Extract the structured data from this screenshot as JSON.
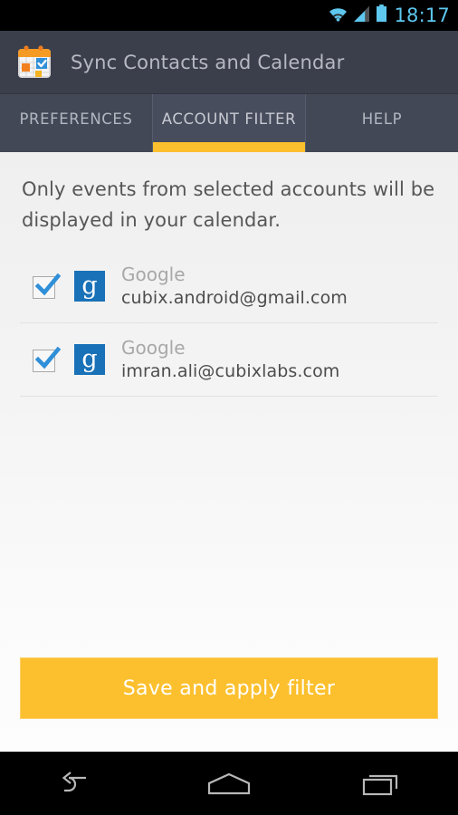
{
  "status_bar": {
    "time": "18:17",
    "icons": [
      "wifi-icon",
      "cellular-signal-icon",
      "battery-icon"
    ],
    "accent_color": "#5ec8ef",
    "background": "#000000"
  },
  "action_bar": {
    "app_icon": "calendar-sync-app-icon",
    "title": "Sync Contacts and Calendar",
    "background": "#3b3f4c",
    "title_color": "#b6b9c2"
  },
  "tabs": {
    "active_index": 1,
    "accent_color": "#fcc02e",
    "items": [
      {
        "label": "PREFERENCES",
        "name": "tab-preferences"
      },
      {
        "label": "ACCOUNT FILTER",
        "name": "tab-account-filter"
      },
      {
        "label": "HELP",
        "name": "tab-help"
      }
    ]
  },
  "content": {
    "intro_text": "Only events from selected accounts will be displayed in your calendar.",
    "accounts": [
      {
        "provider": "Google",
        "email": "cubix.android@gmail.com",
        "checked": true,
        "logo_letter": "g",
        "logo_color": "#1971b8"
      },
      {
        "provider": "Google",
        "email": "imran.ali@cubixlabs.com",
        "checked": true,
        "logo_letter": "g",
        "logo_color": "#1971b8"
      }
    ]
  },
  "save_button": {
    "label": "Save and apply filter",
    "background": "#fcc02e",
    "text_color": "#ffffff"
  },
  "nav_bar": {
    "background": "#000000",
    "buttons": [
      {
        "name": "nav-back-button",
        "icon": "back-arrow-icon"
      },
      {
        "name": "nav-home-button",
        "icon": "home-icon"
      },
      {
        "name": "nav-recents-button",
        "icon": "recent-apps-icon"
      }
    ]
  }
}
